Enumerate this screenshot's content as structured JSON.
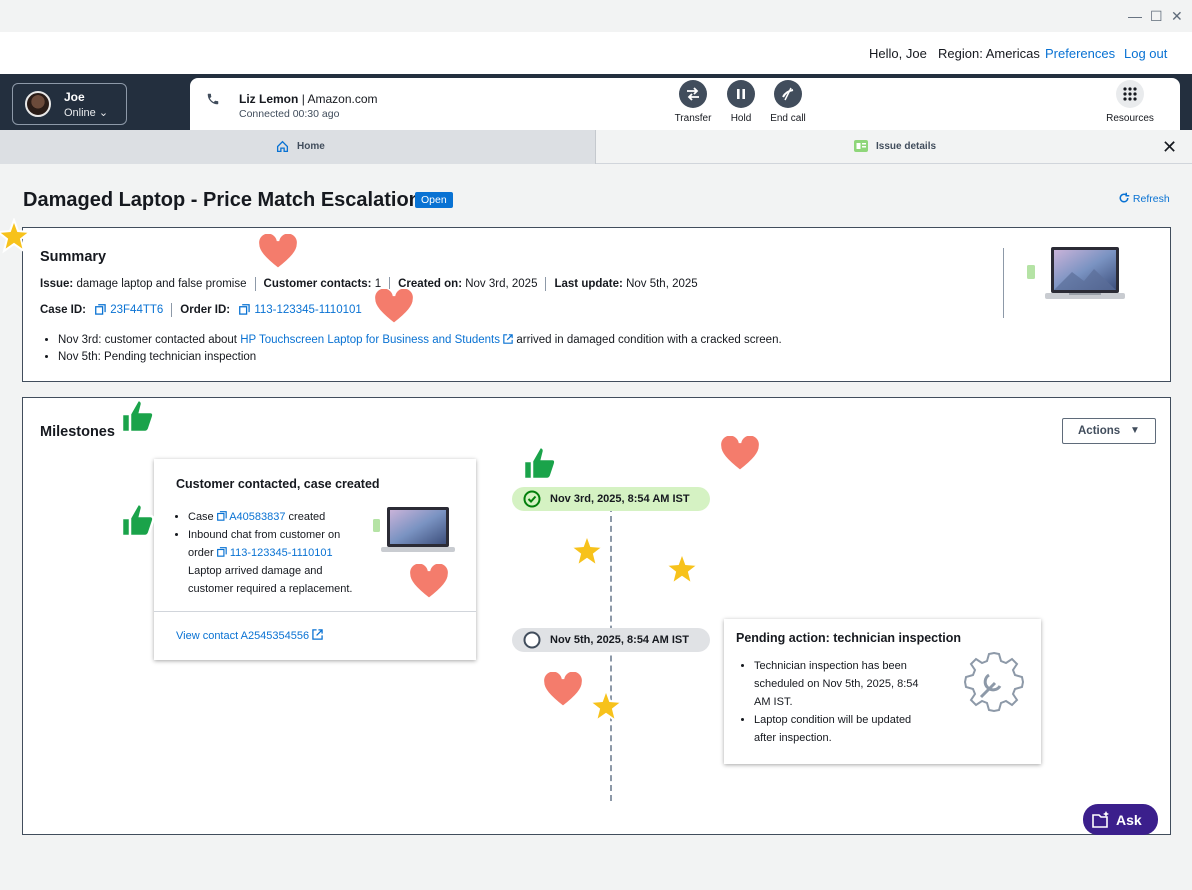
{
  "window": {
    "minimize": "—",
    "maximize": "☐",
    "close": "✕"
  },
  "topnav": {
    "greeting": "Hello, Joe",
    "region": "Region: Americas",
    "preferences": "Preferences",
    "logout": "Log out"
  },
  "agent": {
    "name": "Joe",
    "status": "Online",
    "status_chevron": "⌄"
  },
  "contact": {
    "name": "Liz Lemon",
    "company": "Amazon.com",
    "divider": "|",
    "status": "Connected 00:30 ago"
  },
  "controls": [
    {
      "label": "Transfer",
      "icon": "transfer-icon"
    },
    {
      "label": "Hold",
      "icon": "pause-icon"
    },
    {
      "label": "End call",
      "icon": "end-call-icon"
    },
    {
      "label": "Resources",
      "icon": "grid-icon"
    }
  ],
  "tabs": [
    {
      "label": "Home",
      "icon": "home-icon"
    },
    {
      "label": "Issue details",
      "icon": "issue-icon"
    }
  ],
  "page": {
    "title": "Damaged Laptop - Price Match Escalation",
    "badge": "Open",
    "refresh": "Refresh"
  },
  "summary": {
    "heading": "Summary",
    "issue_label": "Issue:",
    "issue_value": "damage laptop and false promise",
    "contacts_label": "Customer contacts:",
    "contacts_value": "1",
    "created_label": "Created on:",
    "created_value": "Nov 3rd, 2025",
    "update_label": "Last update:",
    "update_value": "Nov 5th, 2025",
    "case_label": "Case ID:",
    "case_value": "23F44TT6",
    "order_label": "Order ID:",
    "order_value": "113-123345-1110101",
    "bullet1_prefix": "Nov 3rd: customer contacted about",
    "bullet1_link": "HP Touchscreen Laptop for Business and Students",
    "bullet1_suffix": "arrived in damaged condition with a cracked screen.",
    "bullet2": "Nov 5th: Pending technician inspection"
  },
  "milestones": {
    "heading": "Milestones",
    "actions": "Actions",
    "actions_caret": "▼",
    "event1": {
      "date": "Nov 3rd, 2025, 8:54 AM IST",
      "title": "Customer contacted, case created",
      "case_prefix": "Case",
      "case_id": "A40583837",
      "case_suffix": "created",
      "chat_line1": "Inbound chat from customer on",
      "order_prefix": "order",
      "order_id": "113-123345-1110101",
      "chat_line3": "Laptop arrived damage and",
      "chat_line4": "customer required a replacement.",
      "view_contact": "View contact A2545354556"
    },
    "event2": {
      "date": "Nov 5th, 2025, 8:54 AM IST",
      "title": "Pending action: technician inspection",
      "bullet1_l1": "Technician inspection has been",
      "bullet1_l2": "scheduled on Nov 5th, 2025, 8:54",
      "bullet1_l3": "AM IST.",
      "bullet2_l1": "Laptop condition will be updated",
      "bullet2_l2": "after inspection."
    }
  },
  "ask": {
    "label": "Ask"
  },
  "colors": {
    "nav": "#232f3e",
    "link": "#0972d3",
    "badge": "#0972d3",
    "ask": "#3b1f8c",
    "success_pill": "#d5f2c3"
  }
}
